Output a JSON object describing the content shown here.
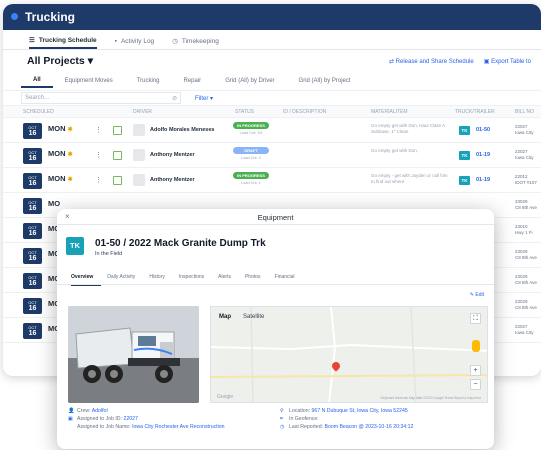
{
  "app": {
    "title": "Trucking"
  },
  "subtabs": [
    {
      "label": "Trucking Schedule",
      "icon": "list-icon",
      "active": true
    },
    {
      "label": "Activity Log",
      "icon": "trash-icon",
      "active": false
    },
    {
      "label": "Timekeeping",
      "icon": "clock-icon",
      "active": false
    }
  ],
  "header": {
    "project_title": "All Projects",
    "release_label": "Release and Share Schedule",
    "export_label": "Export Table to"
  },
  "filters": [
    "All",
    "Equipment Moves",
    "Trucking",
    "Repair",
    "Grid (All) by Driver",
    "Grid (All) by Project"
  ],
  "search": {
    "placeholder": "Search...",
    "filter_label": "Filter"
  },
  "columns": [
    "SCHEDULED",
    "DRIVER",
    "STATUS",
    "ID / DESCRIPTION",
    "MATERIALITEM",
    "TRUCK/TRAILER",
    "BILL NO"
  ],
  "rows": [
    {
      "month": "OCT",
      "date": "16",
      "day": "MON",
      "driver": "Adolfo Morales Meneses",
      "status": "IN PROGRESS",
      "status_color": "green",
      "status_sub": "Load Cnt: 1/9",
      "material": "Go empty get with Don, Haul Class A Subbase, 1\" Clean",
      "tk": "TK",
      "truck": "01-50",
      "bill": "22027",
      "bill2": "Iowa City"
    },
    {
      "month": "OCT",
      "date": "16",
      "day": "MON",
      "driver": "Anthony Mentzer",
      "status": "DRAFT",
      "status_color": "blue",
      "status_sub": "Load Cnt: 0",
      "material": "Go empty get with Don,",
      "tk": "TK",
      "truck": "01-19",
      "bill": "22027",
      "bill2": "Iowa City"
    },
    {
      "month": "OCT",
      "date": "16",
      "day": "MON",
      "driver": "Anthony Mentzer",
      "status": "IN PROGRESS",
      "status_color": "green",
      "status_sub": "Load Cnt: 1",
      "material": "Go empty - get with Jayden or call him to find out where.",
      "tk": "TK",
      "truck": "01-19",
      "bill": "22012",
      "bill2": "IDOT #107"
    },
    {
      "month": "OCT",
      "date": "16",
      "day": "MO",
      "driver": "",
      "status": "",
      "status_color": "",
      "status_sub": "",
      "material": "",
      "tk": "",
      "truck": "",
      "bill": "23029",
      "bill2": "C8 8th Ave"
    },
    {
      "month": "OCT",
      "date": "16",
      "day": "MO",
      "driver": "",
      "status": "",
      "status_color": "",
      "status_sub": "",
      "material": "",
      "tk": "",
      "truck": "",
      "bill": "23010",
      "bill2": "Hwy 1 Fi"
    },
    {
      "month": "OCT",
      "date": "16",
      "day": "MO",
      "driver": "",
      "status": "",
      "status_color": "",
      "status_sub": "",
      "material": "",
      "tk": "",
      "truck": "",
      "bill": "23029",
      "bill2": "C8 8th Ave"
    },
    {
      "month": "OCT",
      "date": "16",
      "day": "MO",
      "driver": "",
      "status": "",
      "status_color": "",
      "status_sub": "",
      "material": "",
      "tk": "",
      "truck": "",
      "bill": "23029",
      "bill2": "C8 8th Ave"
    },
    {
      "month": "OCT",
      "date": "16",
      "day": "MO",
      "driver": "",
      "status": "",
      "status_color": "",
      "status_sub": "",
      "material": "",
      "tk": "",
      "truck": "",
      "bill": "23029",
      "bill2": "C8 8th Ave"
    },
    {
      "month": "OCT",
      "date": "16",
      "day": "MO",
      "driver": "",
      "status": "",
      "status_color": "",
      "status_sub": "",
      "material": "",
      "tk": "",
      "truck": "",
      "bill": "22027",
      "bill2": "Iowa City"
    }
  ],
  "modal": {
    "header": "Equipment",
    "tk": "TK",
    "title": "01-50 / 2022 Mack Granite Dump Trk",
    "subtitle": "In the Field",
    "tabs": [
      "Overview",
      "Daily Activity",
      "History",
      "Inspections",
      "Alerts",
      "Photos",
      "Financial"
    ],
    "edit_label": "Edit",
    "map_tabs": [
      "Map",
      "Satellite"
    ],
    "map_footer": "Keyboard shortcuts   Map data ©2023 Google   Terms   Report a map error",
    "google_label": "Google",
    "crew_label": "Crew:",
    "crew_value": "AdolfoI",
    "job_id_label": "Assigned to Job ID:",
    "job_id_value": "22027",
    "job_name_label": "Assigned to Job Name:",
    "job_name_value": "Iowa City Rochester Ave Reconstruction",
    "location_label": "Location:",
    "location_value": "967 N Dubuque St, Iowa City, Iowa 52245",
    "geofence_label": "In Geofence:",
    "last_reported_label": "Last Reported:",
    "last_reported_value": "Boom Beacon @ 2023-10-16 20:34:12"
  },
  "colors": {
    "navy": "#1e3a68",
    "teal": "#17a2b8",
    "link": "#2563eb",
    "green_status": "#4caf50"
  }
}
